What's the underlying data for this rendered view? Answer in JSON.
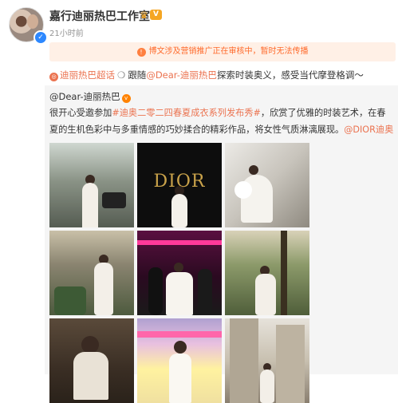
{
  "post": {
    "author": "嘉行迪丽热巴工作室",
    "level_badge": "V",
    "crown_icon": "crown-icon",
    "timestamp": "21小时前",
    "notice": "博文涉及营销推广正在审核中，暂时无法传播",
    "super_topic": "迪丽热巴超话",
    "text_follow": "跟随",
    "mention": "@Dear-迪丽热巴",
    "text_tail": "探索时装奥义，感受当代摩登格调～"
  },
  "repost": {
    "author": "@Dear-迪丽热巴",
    "text_a": "很开心受邀参加",
    "hashtag": "#迪奥二零二四春夏成衣系列发布秀#",
    "text_b": "，欣赏了优雅的时装艺术，在春夏的生机色彩中与多重情感的巧妙揉合的精彩作品，将女性气质淋漓展现。",
    "mention_dior": "@DIOR迪奥",
    "image_text": "DIOR"
  },
  "colors": {
    "link": "#eb7350",
    "notice_bg": "#fff0e6",
    "notice_text": "#ff6a2b",
    "repost_bg": "#f5f5f5"
  }
}
